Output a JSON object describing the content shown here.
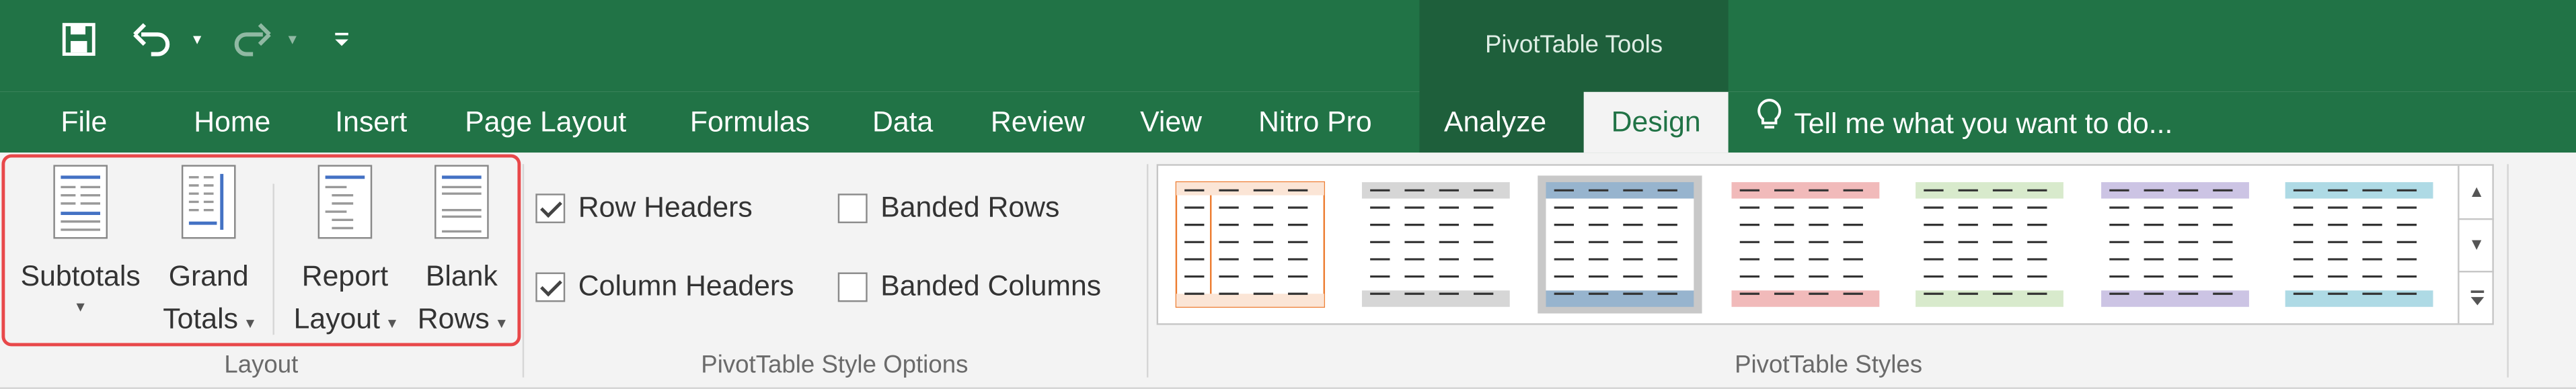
{
  "title_bar": {
    "context_tab_group": "PivotTable Tools"
  },
  "qat": {
    "save_icon": "save-icon",
    "undo_icon": "undo-icon",
    "redo_icon": "redo-icon",
    "customize_icon": "customize-qat-icon"
  },
  "tabs": {
    "file": "File",
    "home": "Home",
    "insert": "Insert",
    "page_layout": "Page Layout",
    "formulas": "Formulas",
    "data": "Data",
    "review": "Review",
    "view": "View",
    "nitro": "Nitro Pro",
    "analyze": "Analyze",
    "design": "Design",
    "active": "Design"
  },
  "tell_me": {
    "icon": "lightbulb-icon",
    "text": "Tell me what you want to do..."
  },
  "layout_group": {
    "label": "Layout",
    "subtotals": {
      "line1": "Subtotals",
      "icon": "subtotals-icon"
    },
    "grand_totals": {
      "line1": "Grand",
      "line2": "Totals",
      "icon": "grand-totals-icon"
    },
    "report_layout": {
      "line1": "Report",
      "line2": "Layout",
      "icon": "report-layout-icon"
    },
    "blank_rows": {
      "line1": "Blank",
      "line2": "Rows",
      "icon": "blank-rows-icon"
    }
  },
  "style_options_group": {
    "label": "PivotTable Style Options",
    "row_headers": {
      "label": "Row Headers",
      "checked": true
    },
    "column_headers": {
      "label": "Column Headers",
      "checked": true
    },
    "banded_rows": {
      "label": "Banded Rows",
      "checked": false
    },
    "banded_columns": {
      "label": "Banded Columns",
      "checked": false
    }
  },
  "styles_group": {
    "label": "PivotTable Styles",
    "styles": [
      {
        "name": "style-orange-outline",
        "accent": "#ed7d31"
      },
      {
        "name": "style-gray",
        "accent": "#a5a5a5"
      },
      {
        "name": "style-blue",
        "accent": "#5b9bd5"
      },
      {
        "name": "style-red",
        "accent": "#e06666"
      },
      {
        "name": "style-green",
        "accent": "#a9d18e"
      },
      {
        "name": "style-purple",
        "accent": "#8e7cc3"
      },
      {
        "name": "style-teal",
        "accent": "#4bacc6"
      }
    ],
    "selected_index": 2
  },
  "colors": {
    "ribbon_green": "#217346",
    "context_green": "#1e5f3b",
    "highlight": "#e8484a"
  }
}
